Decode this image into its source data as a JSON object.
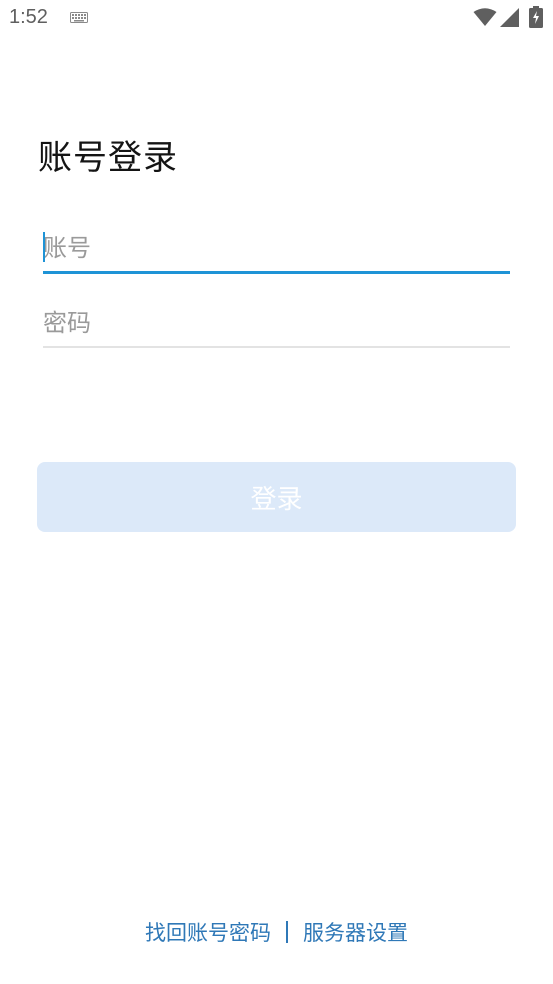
{
  "status_bar": {
    "time": "1:52",
    "icons": [
      "keyboard-icon",
      "wifi-icon",
      "signal-icon",
      "battery-icon"
    ]
  },
  "page": {
    "title": "账号登录"
  },
  "form": {
    "account_placeholder": "账号",
    "account_value": "",
    "password_placeholder": "密码",
    "password_value": ""
  },
  "actions": {
    "login_label": "登录"
  },
  "footer": {
    "recover_label": "找回账号密码",
    "server_settings_label": "服务器设置"
  },
  "colors": {
    "accent": "#1e93d6",
    "button_disabled_bg": "#dce9f9",
    "link": "#2f78b7"
  }
}
